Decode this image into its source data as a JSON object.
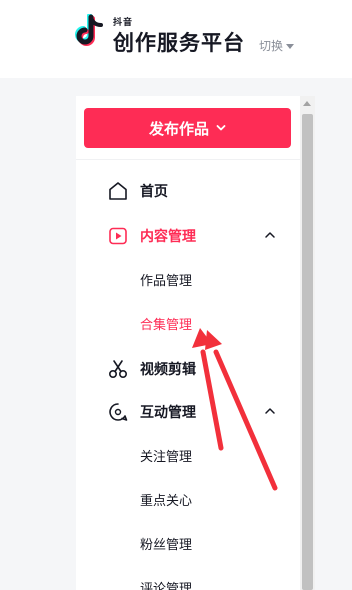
{
  "header": {
    "brand_small": "抖音",
    "brand_title": "创作服务平台",
    "switch_label": "切换"
  },
  "sidebar": {
    "publish_label": "发布作品",
    "items": [
      {
        "label": "首页",
        "icon": "home-icon"
      },
      {
        "label": "内容管理",
        "icon": "play-square-icon",
        "active": true,
        "expanded": true,
        "children": [
          {
            "label": "作品管理"
          },
          {
            "label": "合集管理",
            "active": true
          }
        ]
      },
      {
        "label": "视频剪辑",
        "icon": "scissors-icon"
      },
      {
        "label": "互动管理",
        "icon": "chat-bubble-icon",
        "expanded": true,
        "children": [
          {
            "label": "关注管理"
          },
          {
            "label": "重点关心"
          },
          {
            "label": "粉丝管理"
          },
          {
            "label": "评论管理"
          }
        ]
      }
    ]
  },
  "colors": {
    "accent": "#fe2c55",
    "annotation_arrow": "#f2303b"
  }
}
